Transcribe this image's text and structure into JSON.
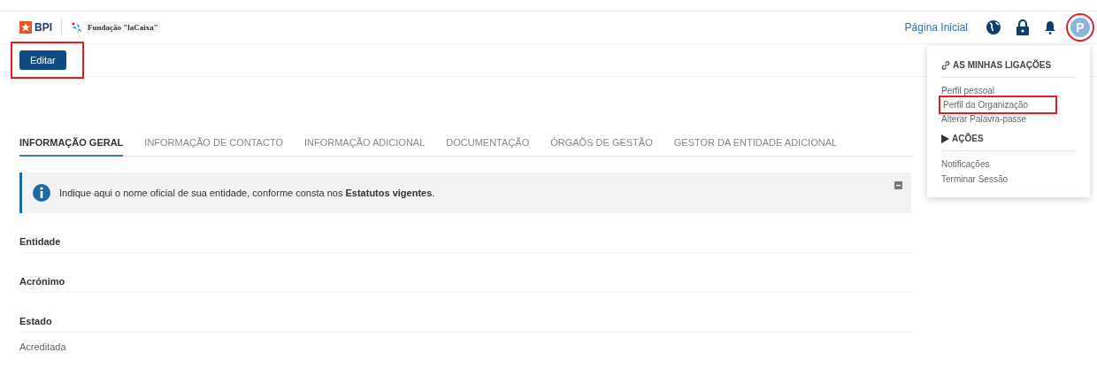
{
  "header": {
    "logo_bpi": "BPI",
    "logo_fundacao": "Fundação \"laCaixa\"",
    "home_link": "Página Inicial",
    "avatar_letter": "P",
    "avatar_highlighted": true
  },
  "toolbar": {
    "edit_button": "Editar",
    "edit_highlighted": true
  },
  "tabs": [
    {
      "label": "INFORMAÇÃO GERAL",
      "selected": true
    },
    {
      "label": "INFORMAÇÃO DE CONTACTO",
      "selected": false
    },
    {
      "label": "INFORMAÇÃO ADICIONAL",
      "selected": false
    },
    {
      "label": "DOCUMENTAÇÃO",
      "selected": false
    },
    {
      "label": "ÓRGAÕS DE GESTÃO",
      "selected": false
    },
    {
      "label": "GESTOR DA ENTIDADE ADICIONAL",
      "selected": false
    }
  ],
  "info_box": {
    "text": "Indique aqui o nome oficial de sua entidade, conforme consta nos **Estatutos vigentes**."
  },
  "fields": [
    {
      "label": "Entidade"
    },
    {
      "label": "Acrónimo"
    },
    {
      "label": "Estado",
      "value": "Acreditada"
    }
  ],
  "user_menu": {
    "sections": [
      {
        "title": "AS MINHAS LIGAÇÕES",
        "kind": "link",
        "items": [
          {
            "label": "Perfil pessoal",
            "highlighted": false
          },
          {
            "label": "Perfil da Organização",
            "highlighted": true
          },
          {
            "label": "Alterar Palavra-passe",
            "highlighted": false
          }
        ]
      },
      {
        "title": "AÇÕES",
        "kind": "play",
        "items": [
          {
            "label": "Notificações",
            "highlighted": false
          },
          {
            "label": "Terminar Sessão",
            "highlighted": false
          }
        ]
      }
    ]
  }
}
